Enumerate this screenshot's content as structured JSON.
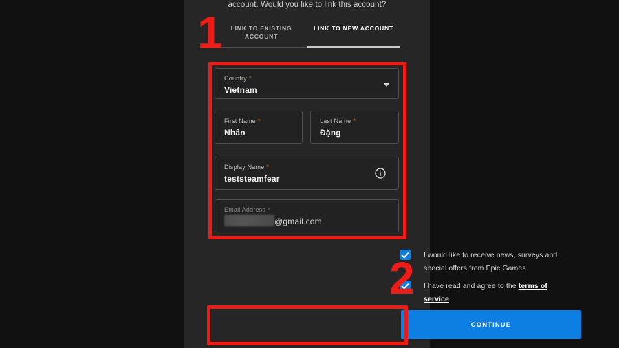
{
  "header": {
    "question": "account. Would you like to link this account?"
  },
  "tabs": [
    {
      "label": "LINK TO EXISTING ACCOUNT",
      "active": false
    },
    {
      "label": "LINK TO NEW ACCOUNT",
      "active": true
    }
  ],
  "form": {
    "country": {
      "label": "Country",
      "required_marker": "*",
      "value": "Vietnam",
      "chevron_icon": "chevron-down-icon"
    },
    "first_name": {
      "label": "First Name",
      "required_marker": "*",
      "value": "Nhân"
    },
    "last_name": {
      "label": "Last Name",
      "required_marker": "*",
      "value": "Đặng"
    },
    "display_name": {
      "label": "Display Name",
      "required_marker": "*",
      "value": "teststeamfear",
      "info_icon": "info-circle-icon"
    },
    "email": {
      "label": "Email Address",
      "required_marker": "*",
      "value_visible": "@gmail.com",
      "redacted": true
    }
  },
  "consents": [
    {
      "checked": true,
      "text": "I would like to receive news, surveys and special offers from Epic Games."
    },
    {
      "checked": true,
      "text_before_link": "I have read and agree to the ",
      "link_text": "terms of service"
    }
  ],
  "actions": {
    "continue_label": "CONTINUE"
  },
  "annotations": [
    {
      "number": "1",
      "target": "form-fields-group"
    },
    {
      "number": "2",
      "target": "continue-button"
    }
  ],
  "colors": {
    "accent_blue": "#0d7fe3",
    "annotation_red": "#ed1c16",
    "required_orange": "#e08a3c",
    "panel_background": "#262626",
    "page_background": "#111111"
  }
}
